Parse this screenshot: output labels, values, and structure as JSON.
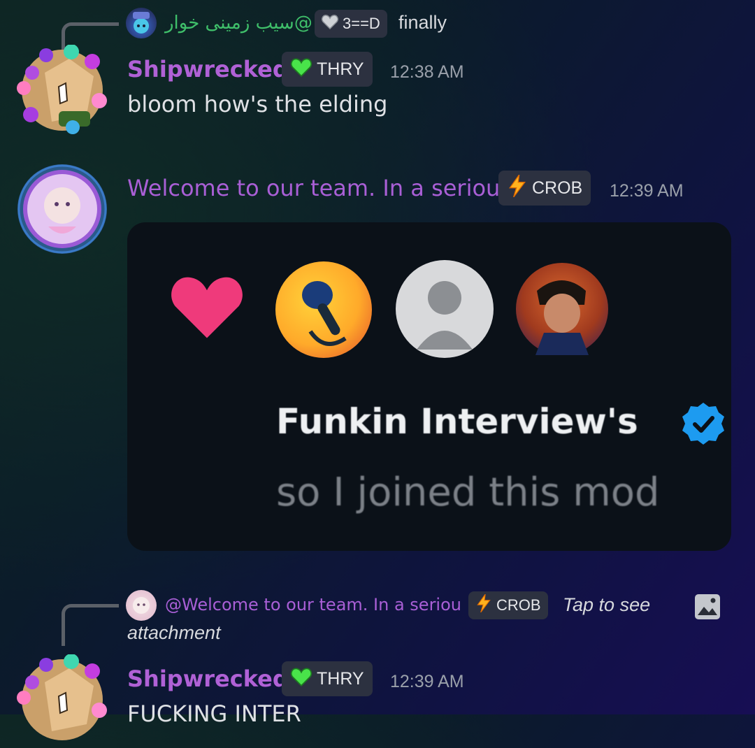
{
  "messages": [
    {
      "reply": {
        "username": "@سیب زمینی خوار",
        "tag_label": "3==D",
        "text": "finally"
      },
      "username": "Shipwrecked",
      "tag_label": "THRY",
      "time": "12:38 AM",
      "text": "bloom how's the elding"
    },
    {
      "username": "Welcome to our team. In a seriou",
      "tag_label": "CROB",
      "time": "12:39 AM",
      "embed": {
        "name": "Funkin Interview's",
        "subtitle": "so I joined this mod"
      }
    },
    {
      "reply": {
        "username": "@Welcome to our team. In a seriou",
        "tag_label": "CROB",
        "text_line1": "Tap to see",
        "text_line2": "attachment"
      },
      "username": "Shipwrecked",
      "tag_label": "THRY",
      "time": "12:39 AM",
      "text": "FUCKING INTER"
    }
  ],
  "colors": {
    "username_shipwrecked": "#b061d6",
    "reply_username_green": "#3fbf6a",
    "reply_username_purple": "#a95fd6",
    "heart": "#ef3a7b",
    "verified_blue": "#1d9bf0"
  },
  "icons": {
    "tag_thry": "green-heart-icon",
    "tag_crob": "lightning-icon",
    "tag_3d": "white-heart-icon",
    "attachment": "image-attachment-icon"
  }
}
